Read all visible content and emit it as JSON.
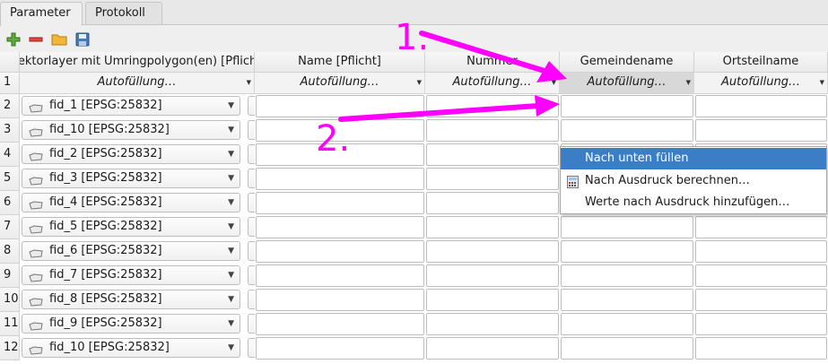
{
  "tabs": [
    "Parameter",
    "Protokoll"
  ],
  "toolbar": {
    "add_icon": "add-row-icon",
    "remove_icon": "remove-row-icon",
    "open_icon": "open-folder-icon",
    "save_icon": "save-icon"
  },
  "columns": [
    "Vektorlayer mit Umringpolygon(en) [Pflicht]",
    "Name [Pflicht]",
    "Nummer",
    "Gemeindename",
    "Ortsteilname"
  ],
  "autofill_label": "Autofüllung…",
  "row_numbers": [
    "1",
    "2",
    "3",
    "4",
    "5",
    "6",
    "7",
    "8",
    "9",
    "10",
    "11",
    "12"
  ],
  "rows": [
    "fid_1 [EPSG:25832]",
    "fid_10 [EPSG:25832]",
    "fid_2 [EPSG:25832]",
    "fid_3 [EPSG:25832]",
    "fid_4 [EPSG:25832]",
    "fid_5 [EPSG:25832]",
    "fid_6 [EPSG:25832]",
    "fid_7 [EPSG:25832]",
    "fid_8 [EPSG:25832]",
    "fid_9 [EPSG:25832]",
    "fid_10 [EPSG:25832]"
  ],
  "dots_label": "…",
  "menu": {
    "items": [
      "Nach unten füllen",
      "Nach Ausdruck berechnen…",
      "Werte nach Ausdruck hinzufügen…"
    ],
    "highlighted": 0
  },
  "annotations": {
    "step1": "1.",
    "step2": "2.",
    "color": "#ff00ff"
  }
}
